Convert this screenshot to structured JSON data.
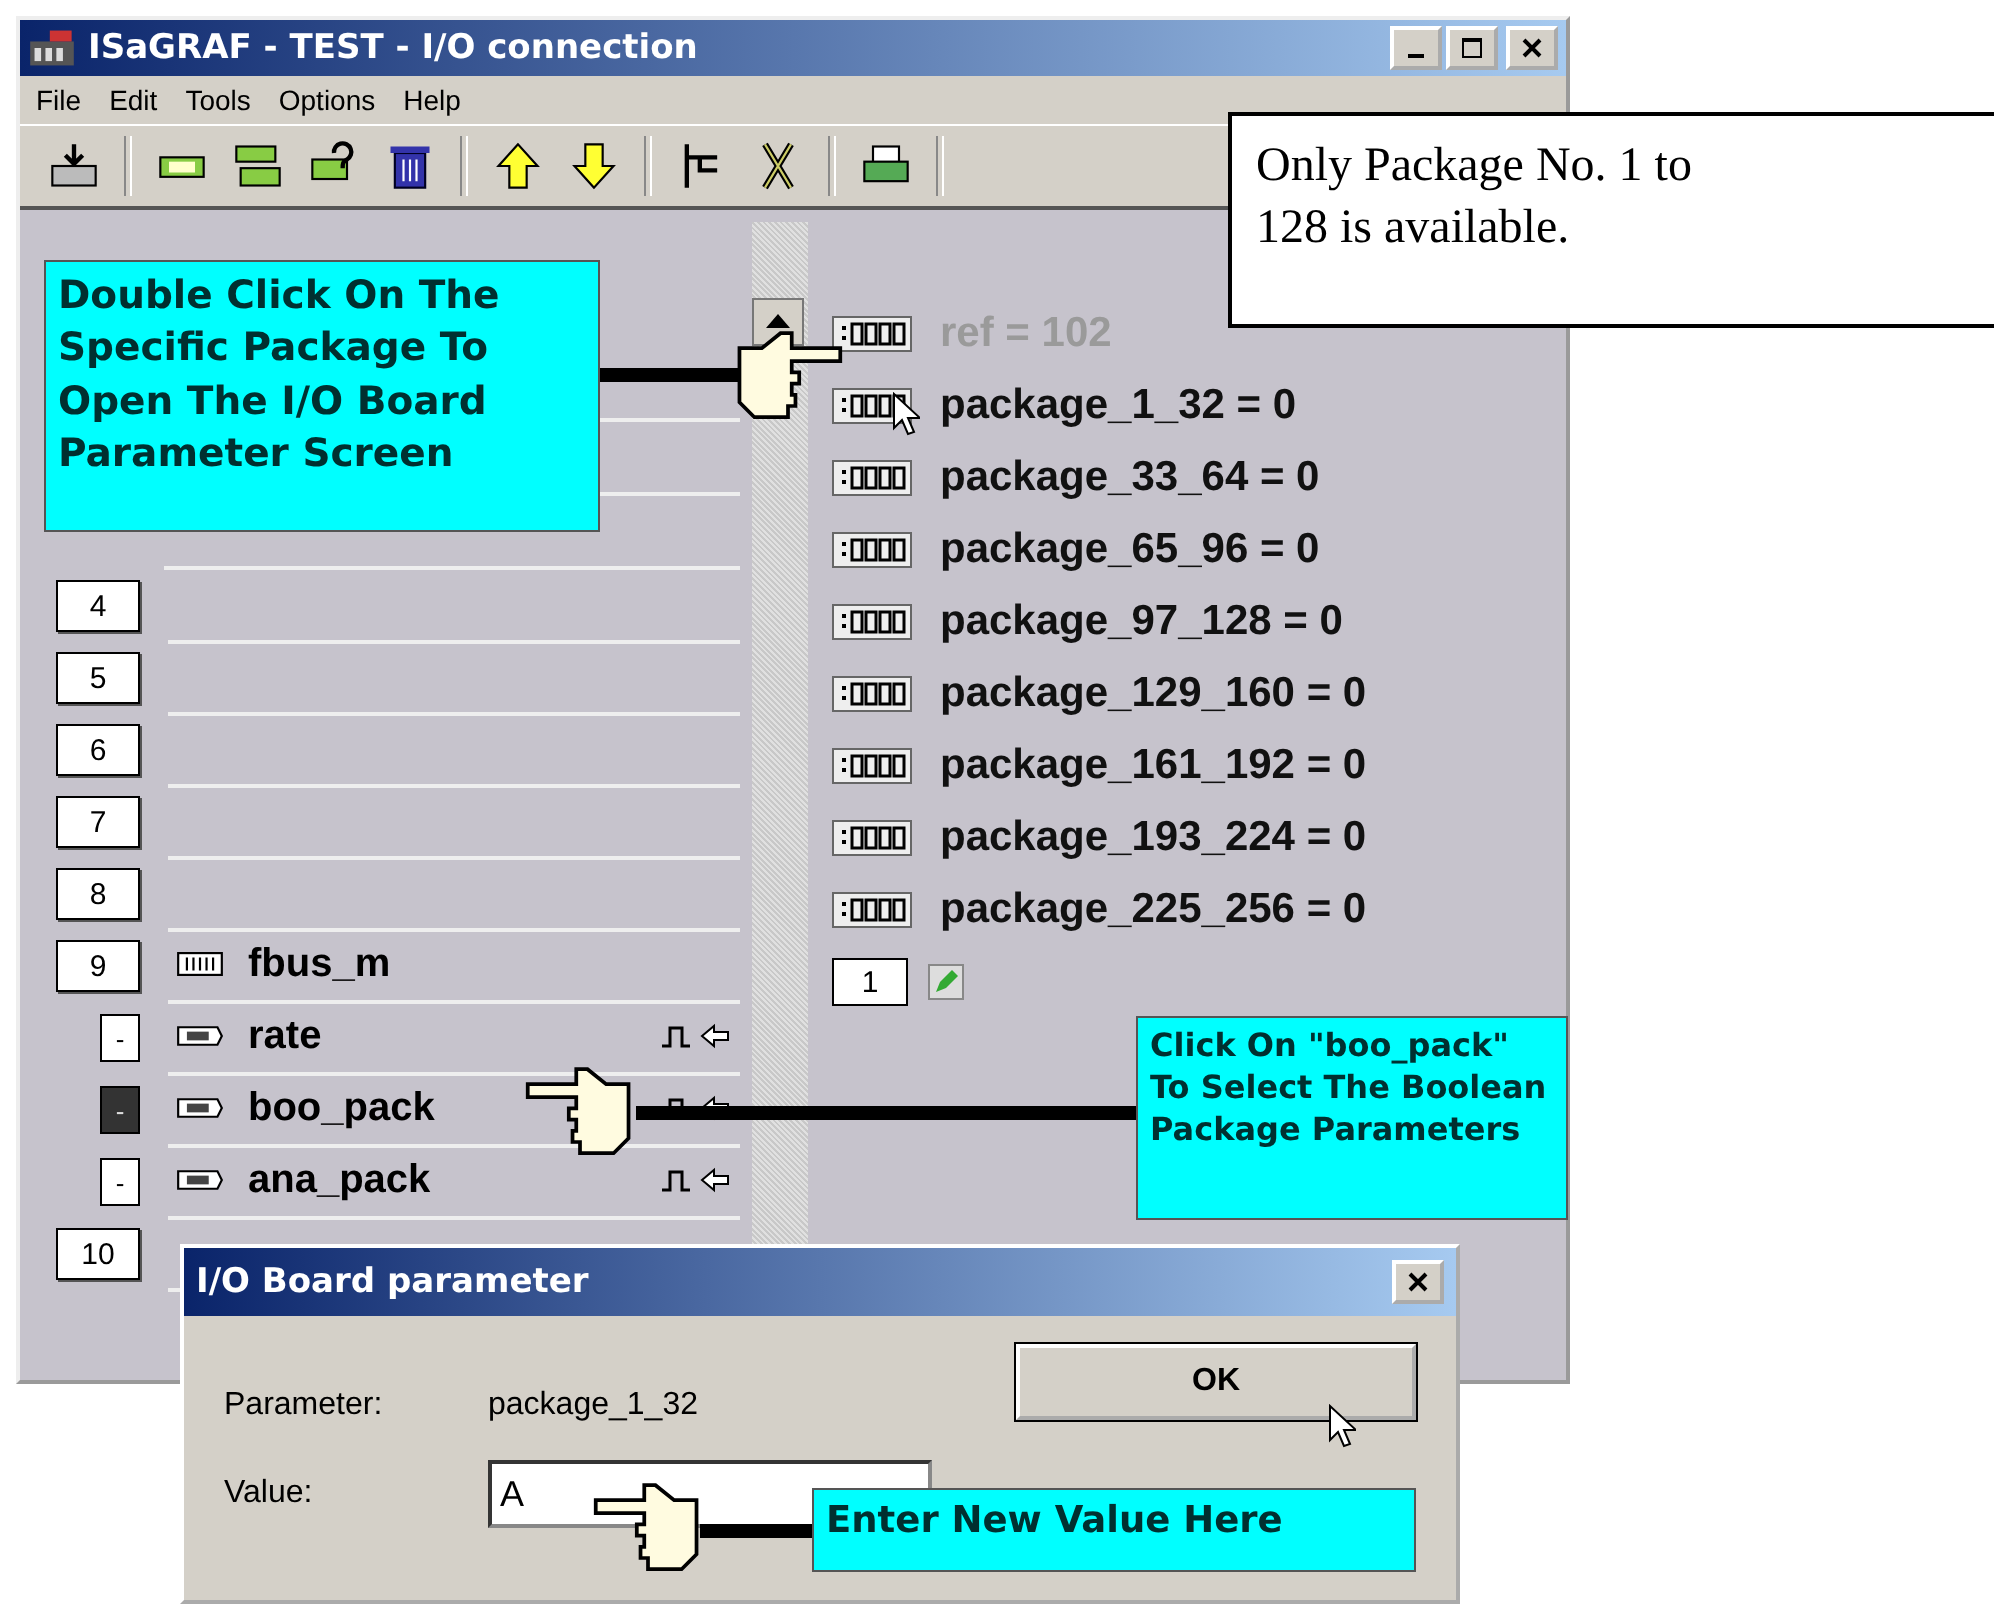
{
  "window": {
    "title": "ISaGRAF - TEST - I/O connection"
  },
  "menu": [
    "File",
    "Edit",
    "Tools",
    "Options",
    "Help"
  ],
  "slots": [
    {
      "number": "4"
    },
    {
      "number": "5"
    },
    {
      "number": "6"
    },
    {
      "number": "7"
    },
    {
      "number": "8"
    },
    {
      "number": "9",
      "label": "fbus_m",
      "children": [
        {
          "marker": "-",
          "label": "rate",
          "selected": false
        },
        {
          "marker": "-",
          "label": "boo_pack",
          "selected": true
        },
        {
          "marker": "-",
          "label": "ana_pack",
          "selected": false
        }
      ]
    },
    {
      "number": "10"
    }
  ],
  "variables": [
    {
      "text": "ref = 102",
      "disabled": true
    },
    {
      "text": "package_1_32 = 0",
      "disabled": false
    },
    {
      "text": "package_33_64 = 0",
      "disabled": false
    },
    {
      "text": "package_65_96 = 0",
      "disabled": false
    },
    {
      "text": "package_97_128 = 0",
      "disabled": false
    },
    {
      "text": "package_129_160 = 0",
      "disabled": false
    },
    {
      "text": "package_161_192 = 0",
      "disabled": false
    },
    {
      "text": "package_193_224 = 0",
      "disabled": false
    },
    {
      "text": "package_225_256 = 0",
      "disabled": false
    }
  ],
  "index": "1",
  "callouts": [
    "Double Click On The Specific Package To Open The I/O Board Parameter Screen",
    "Click On \"boo_pack\" To Select The Boolean Package Parameters",
    "Enter New Value Here"
  ],
  "note": "Only Package No. 1 to 128 is available.",
  "dialog": {
    "title": "I/O Board parameter",
    "parameter_label": "Parameter:",
    "parameter_value": "package_1_32",
    "value_label": "Value:",
    "value": "A",
    "ok": "OK"
  }
}
